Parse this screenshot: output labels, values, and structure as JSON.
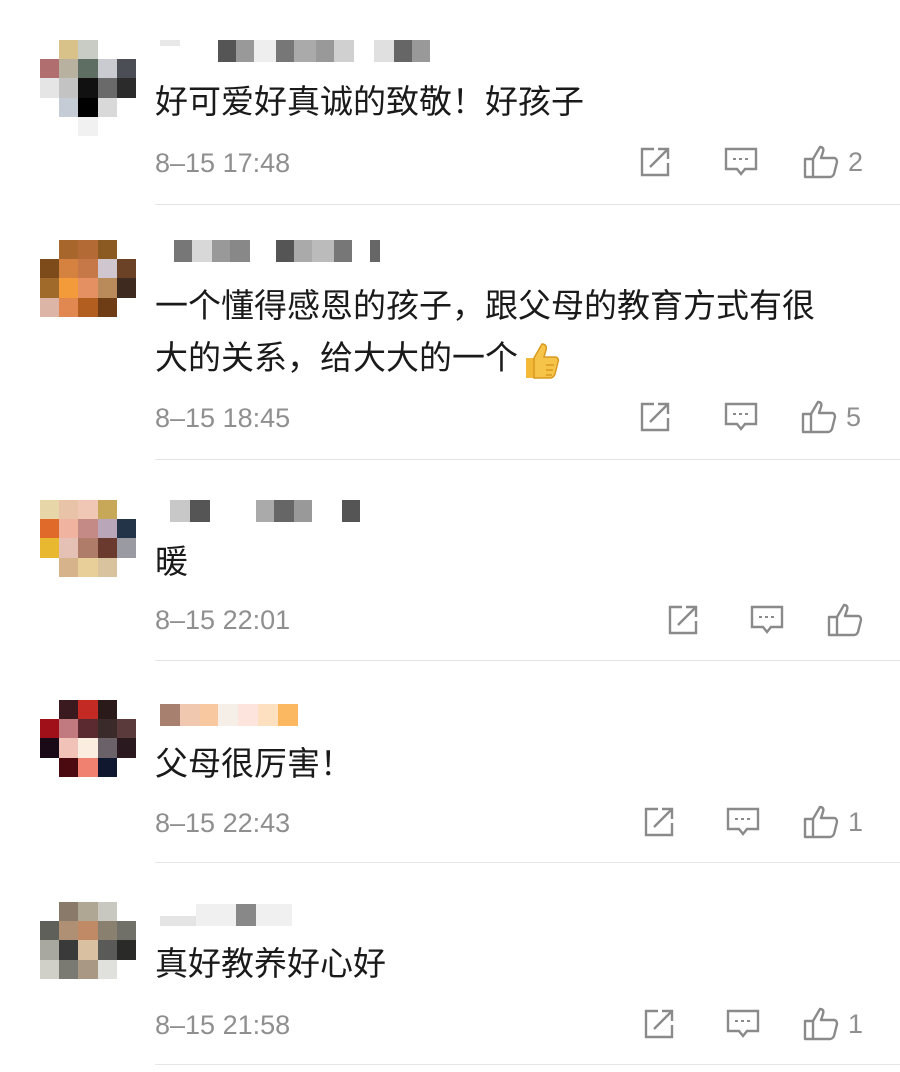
{
  "comments": [
    {
      "text": "好可爱好真诚的致敬！好孩子",
      "time": "8–15 17:48",
      "likes": "2"
    },
    {
      "text": "一个懂得感恩的孩子，跟父母的教育方式有很大的关系，给大大的一个",
      "time": "8–15 18:45",
      "likes": "5",
      "emoji": "thumbs-up-emoji"
    },
    {
      "text": "暖",
      "time": "8–15 22:01",
      "likes": ""
    },
    {
      "text": "父母很厉害！",
      "time": "8–15 22:43",
      "likes": "1"
    },
    {
      "text": "真好教养好心好",
      "time": "8–15 21:58",
      "likes": "1"
    }
  ],
  "icons": {
    "share": "share-icon",
    "reply": "reply-icon",
    "like": "like-icon"
  },
  "colors": {
    "text": "#1a1a1a",
    "meta": "#8f8f8f",
    "icon": "#8a8a8a",
    "divider": "#e6e6e6"
  }
}
